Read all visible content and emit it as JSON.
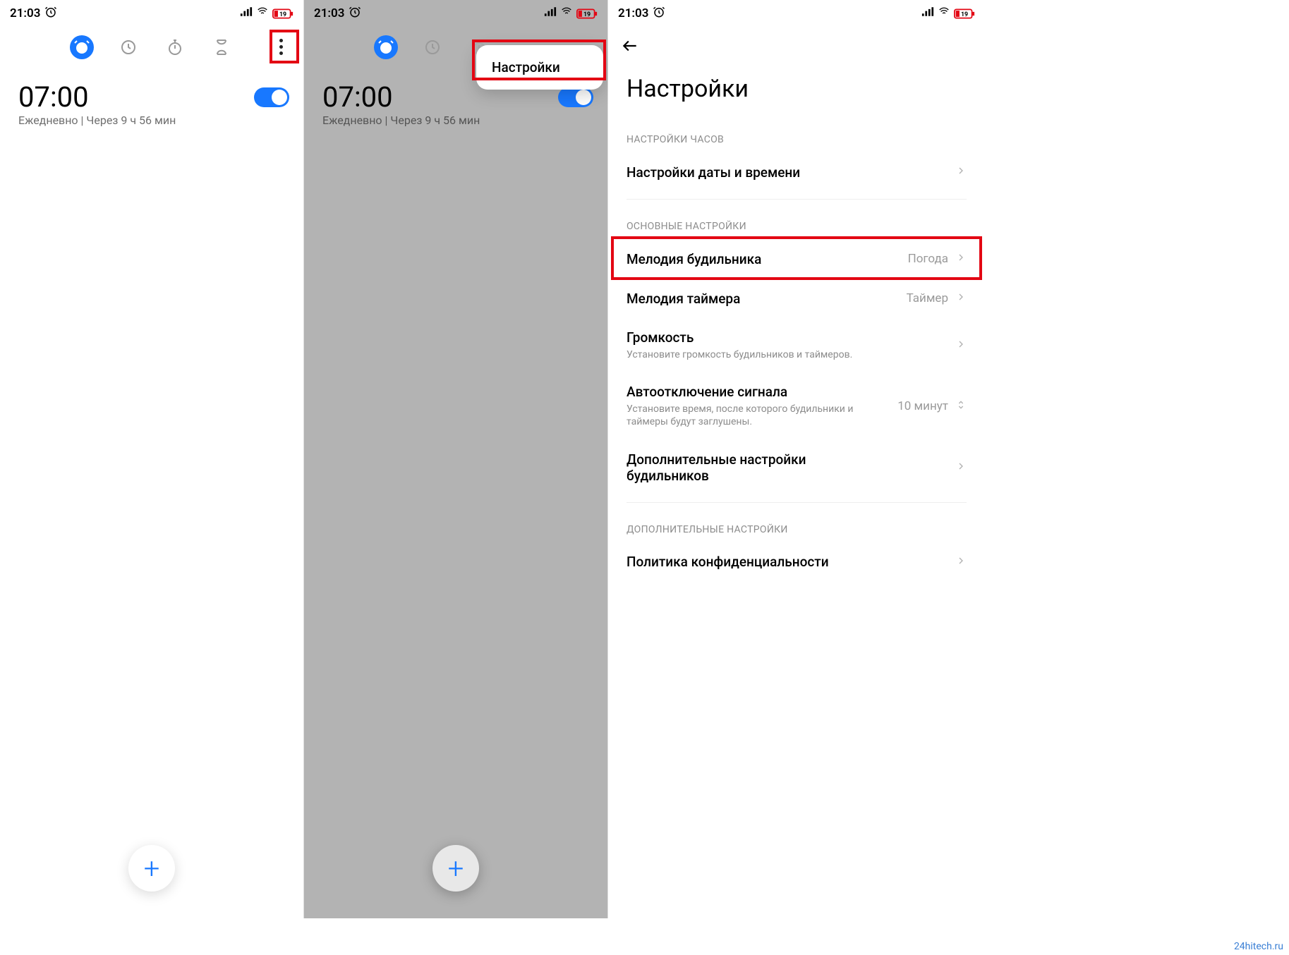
{
  "status": {
    "time": "21:03",
    "battery": "19"
  },
  "tabs": [
    "alarm",
    "clock",
    "stopwatch",
    "timer"
  ],
  "alarm": {
    "time": "07:00",
    "sub": "Ежедневно  |  Через 9 ч 56 мин"
  },
  "popup": {
    "settings": "Настройки"
  },
  "settings": {
    "title": "Настройки",
    "section_clock": "НАСТРОЙКИ ЧАСОВ",
    "datetime": "Настройки даты и времени",
    "section_main": "ОСНОВНЫЕ НАСТРОЙКИ",
    "alarm_sound": {
      "label": "Мелодия будильника",
      "value": "Погода"
    },
    "timer_sound": {
      "label": "Мелодия таймера",
      "value": "Таймер"
    },
    "volume": {
      "label": "Громкость",
      "sub": "Установите громкость будильников и таймеров."
    },
    "autooff": {
      "label": "Автоотключение сигнала",
      "sub": "Установите время, после которого будильники и таймеры будут заглушены.",
      "value": "10 минут"
    },
    "extra_alarm": "Дополнительные настройки будильников",
    "section_extra": "ДОПОЛНИТЕЛЬНЫЕ НАСТРОЙКИ",
    "privacy": "Политика конфиденциальности"
  },
  "watermark": "24hitech.ru"
}
